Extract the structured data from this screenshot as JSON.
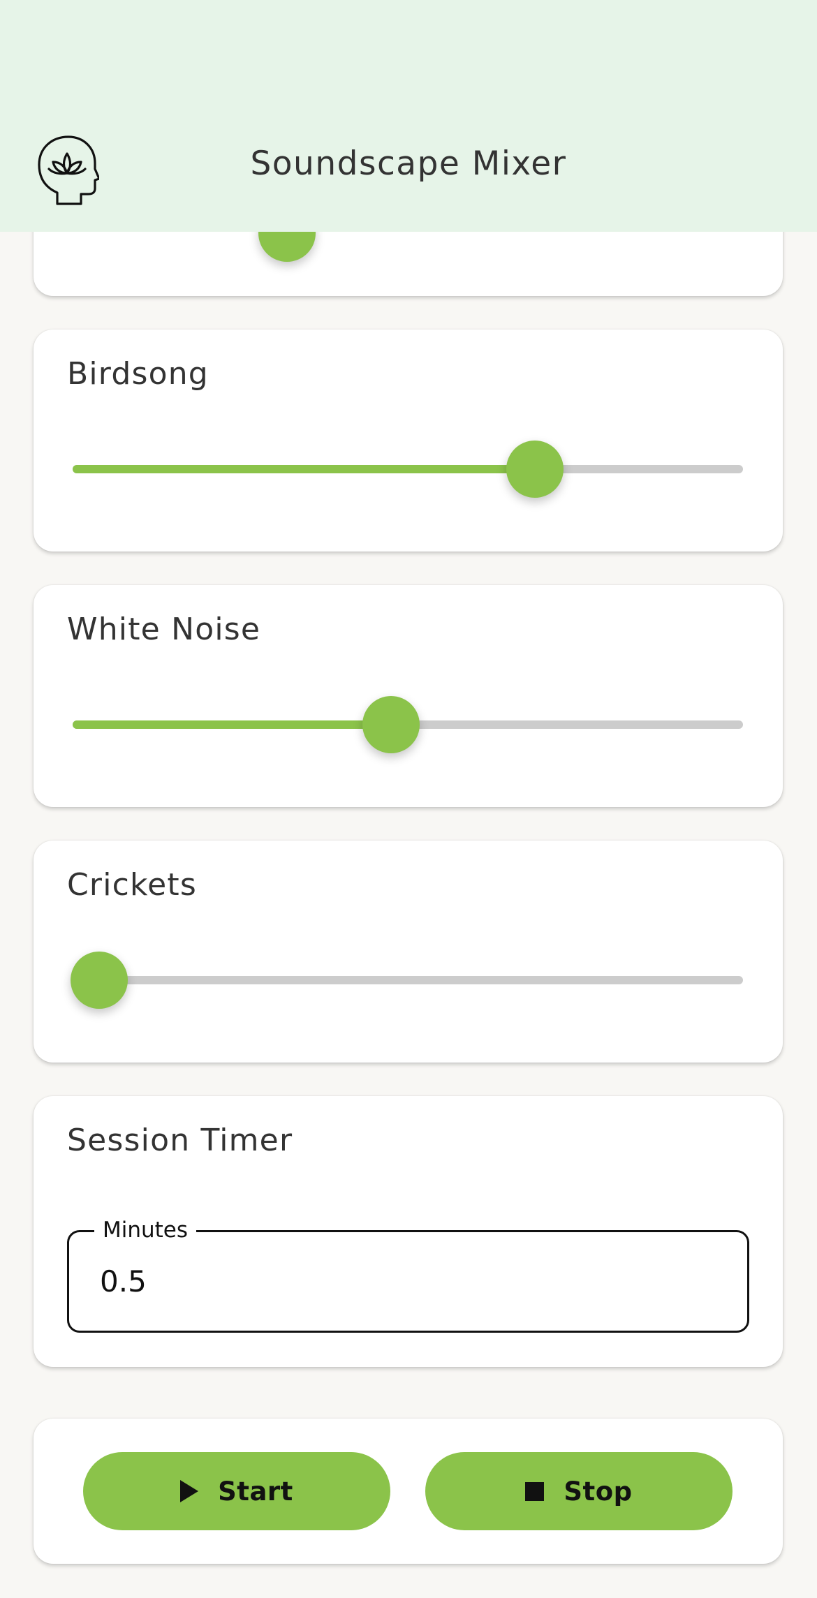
{
  "header": {
    "title": "Soundscape Mixer",
    "logo_icon": "meditation-head-lotus-icon"
  },
  "sound_channels": [
    {
      "label": "Birdsong",
      "level_percent": 69
    },
    {
      "label": "White Noise",
      "level_percent": 47.5
    },
    {
      "label": "Crickets",
      "level_percent": 4
    }
  ],
  "partially_hidden_channel": {
    "level_percent": 32
  },
  "timer": {
    "title": "Session Timer",
    "field_label": "Minutes",
    "value": "0.5"
  },
  "actions": {
    "start_label": "Start",
    "start_icon": "play-icon",
    "stop_label": "Stop",
    "stop_icon": "stop-icon"
  },
  "colors": {
    "accent": "#8bc34a",
    "header_background": "#e6f4e8",
    "page_background": "#f8f7f4",
    "track": "#cccccc"
  }
}
